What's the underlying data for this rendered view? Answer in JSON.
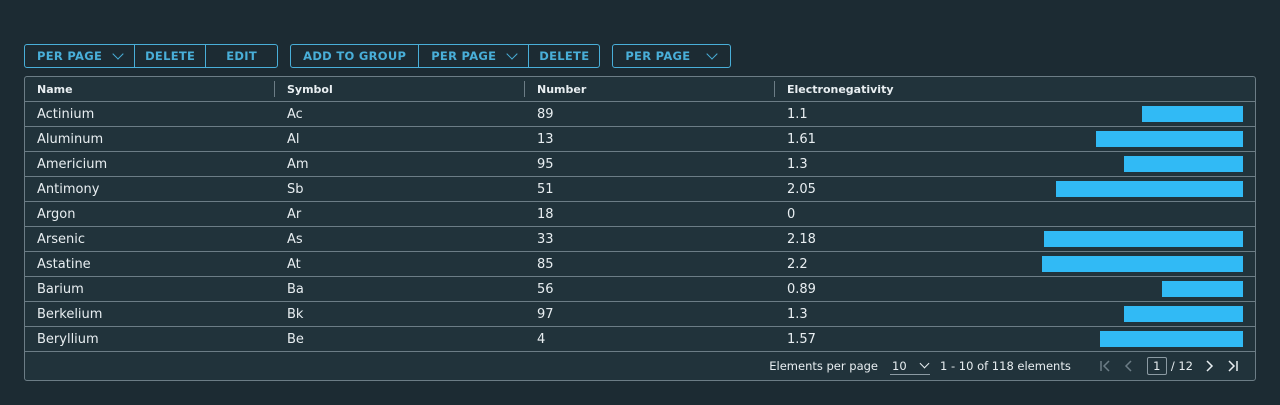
{
  "toolbar": {
    "group1": [
      "PER PAGE",
      "DELETE",
      "EDIT"
    ],
    "group2": [
      "ADD TO GROUP",
      "PER PAGE",
      "DELETE"
    ],
    "group3": [
      "PER PAGE"
    ]
  },
  "columns": [
    "Name",
    "Symbol",
    "Number",
    "Electronegativity"
  ],
  "rows": [
    {
      "name": "Actinium",
      "symbol": "Ac",
      "number": "89",
      "en": "1.1"
    },
    {
      "name": "Aluminum",
      "symbol": "Al",
      "number": "13",
      "en": "1.61"
    },
    {
      "name": "Americium",
      "symbol": "Am",
      "number": "95",
      "en": "1.3"
    },
    {
      "name": "Antimony",
      "symbol": "Sb",
      "number": "51",
      "en": "2.05"
    },
    {
      "name": "Argon",
      "symbol": "Ar",
      "number": "18",
      "en": "0"
    },
    {
      "name": "Arsenic",
      "symbol": "As",
      "number": "33",
      "en": "2.18"
    },
    {
      "name": "Astatine",
      "symbol": "At",
      "number": "85",
      "en": "2.2"
    },
    {
      "name": "Barium",
      "symbol": "Ba",
      "number": "56",
      "en": "0.89"
    },
    {
      "name": "Berkelium",
      "symbol": "Bk",
      "number": "97",
      "en": "1.3"
    },
    {
      "name": "Beryllium",
      "symbol": "Be",
      "number": "4",
      "en": "1.57"
    }
  ],
  "bar_max": 2.2,
  "footer": {
    "per_page_label": "Elements per page",
    "per_page_value": "10",
    "range_text": "1 - 10 of 118 elements",
    "current_page": "1",
    "total_pages": "/ 12"
  },
  "colors": {
    "accent": "#49afd9",
    "bar": "#31baf5",
    "background": "#1c2b33"
  }
}
